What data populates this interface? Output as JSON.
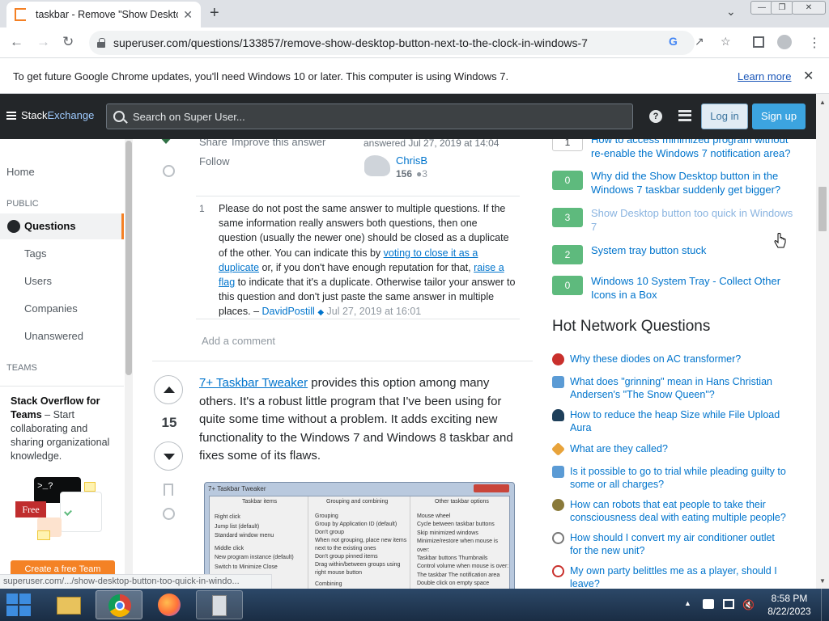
{
  "browser": {
    "tab_title": "taskbar - Remove \"Show Desktop",
    "tab_close": "✕",
    "new_tab": "+",
    "url": "superuser.com/questions/133857/remove-show-desktop-button-next-to-the-clock-in-windows-7",
    "infobar_message": "To get future Google Chrome updates, you'll need Windows 10 or later. This computer is using Windows 7.",
    "infobar_link": "Learn more"
  },
  "topbar": {
    "logo_stack": "Stack",
    "logo_exchange": "Exchange",
    "search_placeholder": "Search on Super User...",
    "help": "?",
    "login": "Log in",
    "signup": "Sign up"
  },
  "leftnav": {
    "home": "Home",
    "public_header": "PUBLIC",
    "questions": "Questions",
    "tags": "Tags",
    "users": "Users",
    "companies": "Companies",
    "unanswered": "Unanswered",
    "teams_header": "TEAMS",
    "teams_title": "Stack Overflow for Teams",
    "teams_body": " – Start collaborating and sharing organizational knowledge.",
    "teams_img_prompt": ">_?",
    "teams_img_badge": "Free",
    "teams_button": "Create a free Team"
  },
  "answer1": {
    "share": "Share",
    "improve": "Improve this answer",
    "follow": "Follow",
    "answered": "answered Jul 27, 2019 at 14:04",
    "user": "ChrisB",
    "rep": "156",
    "badge": "3",
    "comment_votes": "1",
    "comment_p1": "Please do not post the same answer to multiple questions. If the same information really answers both questions, then one question (usually the newer one) should be closed as a duplicate of the other. You can indicate this by ",
    "comment_link1": "voting to close it as a duplicate",
    "comment_p2": " or, if you don't have enough reputation for that, ",
    "comment_link2": "raise a flag",
    "comment_p3": " to indicate that it's a duplicate. Otherwise tailor your answer to this question and don't just paste the same answer in multiple places. – ",
    "comment_author": "DavidPostill",
    "comment_date": "Jul 27, 2019 at 16:01",
    "add_comment": "Add a comment"
  },
  "answer2": {
    "votes": "15",
    "link": "7+ Taskbar Tweaker",
    "body": " provides this option among many others. It's a robust little program that I've been using for quite some time without a problem. It adds exciting new functionality to the Windows 7 and Windows 8 taskbar and fixes some of its flaws.",
    "screenshot": {
      "title": "7+ Taskbar Tweaker",
      "col1_header": "Taskbar items",
      "col2_header": "Grouping and combining",
      "col3_header": "Other taskbar options",
      "col1": [
        "Right click",
        "Jump list (default)",
        "Standard window menu",
        "Middle click",
        "New program instance (default)",
        "Switch to   Minimize   Close"
      ],
      "col2": [
        "Grouping",
        "Group by Application ID (default)",
        "Don't group",
        "When not grouping, place new items next to the existing ones",
        "Don't group pinned items",
        "Drag within/between groups using right mouse button",
        "Combining"
      ],
      "col3": [
        "Mouse wheel",
        "Cycle between taskbar buttons",
        "Skip minimized windows",
        "Minimize/restore when mouse is over:",
        "Taskbar buttons   Thumbnails",
        "Control volume when mouse is over:",
        "The taskbar   The notification area",
        "Double click on empty space"
      ]
    }
  },
  "related": [
    {
      "count": "1",
      "style": "w",
      "title": "How to access minimized program without re-enable the Windows 7 notification area?"
    },
    {
      "count": "0",
      "style": "g",
      "title": "Why did the Show Desktop button in the Windows 7 taskbar suddenly get bigger?"
    },
    {
      "count": "3",
      "style": "g",
      "title": "Show Desktop button too quick in Windows 7"
    },
    {
      "count": "2",
      "style": "g",
      "title": "System tray button stuck"
    },
    {
      "count": "0",
      "style": "g",
      "title": "Windows 10 System Tray - Collect Other Icons in a Box"
    }
  ],
  "hnq_title": "Hot Network Questions",
  "hnq": [
    {
      "title": "Why these diodes on AC transformer?",
      "color": "#c9302c"
    },
    {
      "title": "What does \"grinning\" mean in Hans Christian Andersen's \"The Snow Queen\"?",
      "color": "#5b9bd5"
    },
    {
      "title": "How to reduce the heap Size while File Upload Aura",
      "color": "#1e3f5a"
    },
    {
      "title": "What are they called?",
      "color": "#e8a33b"
    },
    {
      "title": "Is it possible to go to trial while pleading guilty to some or all charges?",
      "color": "#5b9bd5"
    },
    {
      "title": "How can robots that eat people to take their consciousness deal with eating multiple people?",
      "color": "#8a7a3a"
    },
    {
      "title": "How should I convert my air conditioner outlet for the new unit?",
      "color": "#777777"
    },
    {
      "title": "My own party belittles me as a player, should I leave?",
      "color": "#c9302c"
    }
  ],
  "status_url": "superuser.com/.../show-desktop-button-too-quick-in-windo...",
  "clock": {
    "time": "8:58 PM",
    "date": "8/22/2023"
  }
}
